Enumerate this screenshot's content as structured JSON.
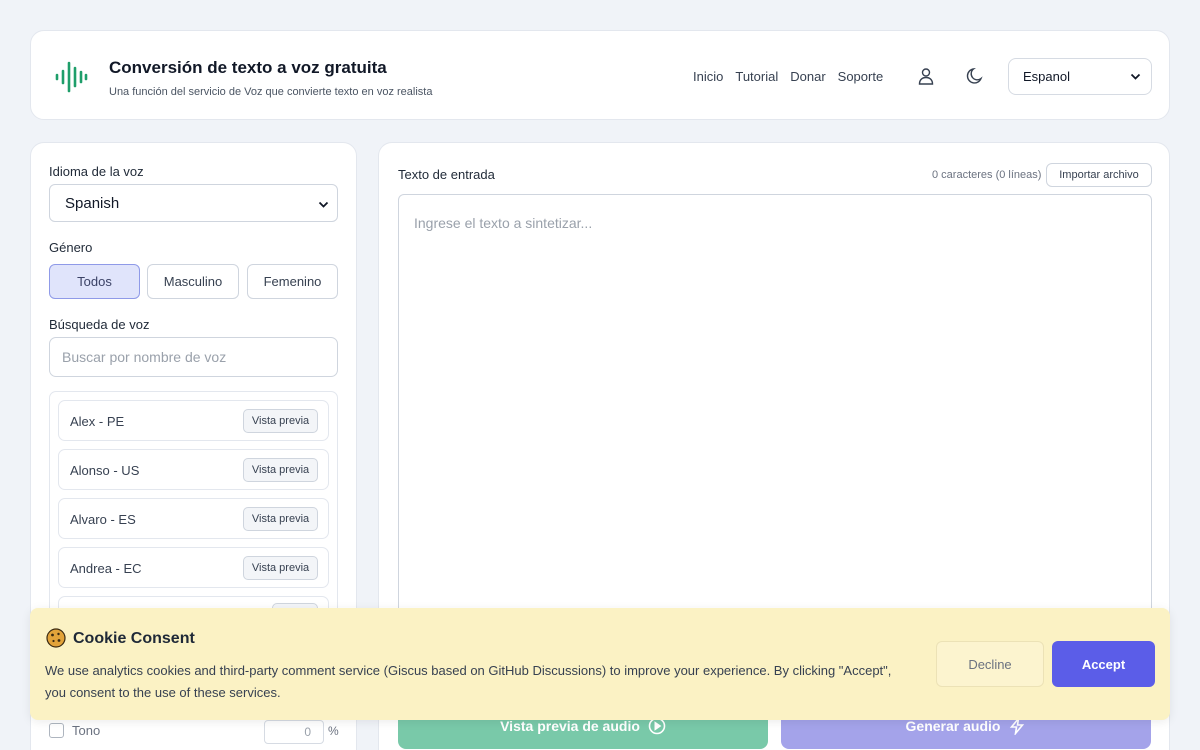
{
  "header": {
    "title": "Conversión de texto a voz gratuita",
    "subtitle": "Una función del servicio de Voz que convierte texto en voz realista",
    "nav": [
      "Inicio",
      "Tutorial",
      "Donar",
      "Soporte"
    ],
    "language": "Espanol",
    "logo_icon": "audio-wave-icon",
    "brand_color": "#1e9e6a"
  },
  "left": {
    "voice_language_label": "Idioma de la voz",
    "voice_language_value": "Spanish",
    "gender_label": "Género",
    "gender_options": [
      "Todos",
      "Masculino",
      "Femenino"
    ],
    "gender_selected": "Todos",
    "search_label": "Búsqueda de voz",
    "search_placeholder": "Buscar por nombre de voz",
    "voices": [
      {
        "name": "Alex - PE",
        "action": "Vista previa"
      },
      {
        "name": "Alonso - US",
        "action": "Vista previa"
      },
      {
        "name": "Alvaro - ES",
        "action": "Vista previa"
      },
      {
        "name": "Andrea - EC",
        "action": "Vista previa"
      }
    ],
    "tono_label": "Tono",
    "tono_value": "0",
    "tono_unit": "%"
  },
  "right": {
    "input_label": "Texto de entrada",
    "count": "0 caracteres (0 líneas)",
    "import_label": "Importar archivo",
    "placeholder": "Ingrese el texto a sintetizar...",
    "preview_audio_label": "Vista previa de audio",
    "generate_audio_label": "Generar audio"
  },
  "cookie": {
    "title": "Cookie Consent",
    "text": "We use analytics cookies and third-party comment service (Giscus based on GitHub Discussions) to improve your experience. By clicking \"Accept\", you consent to the use of these services.",
    "decline_label": "Decline",
    "accept_label": "Accept",
    "accent_color": "#5b5de8"
  }
}
